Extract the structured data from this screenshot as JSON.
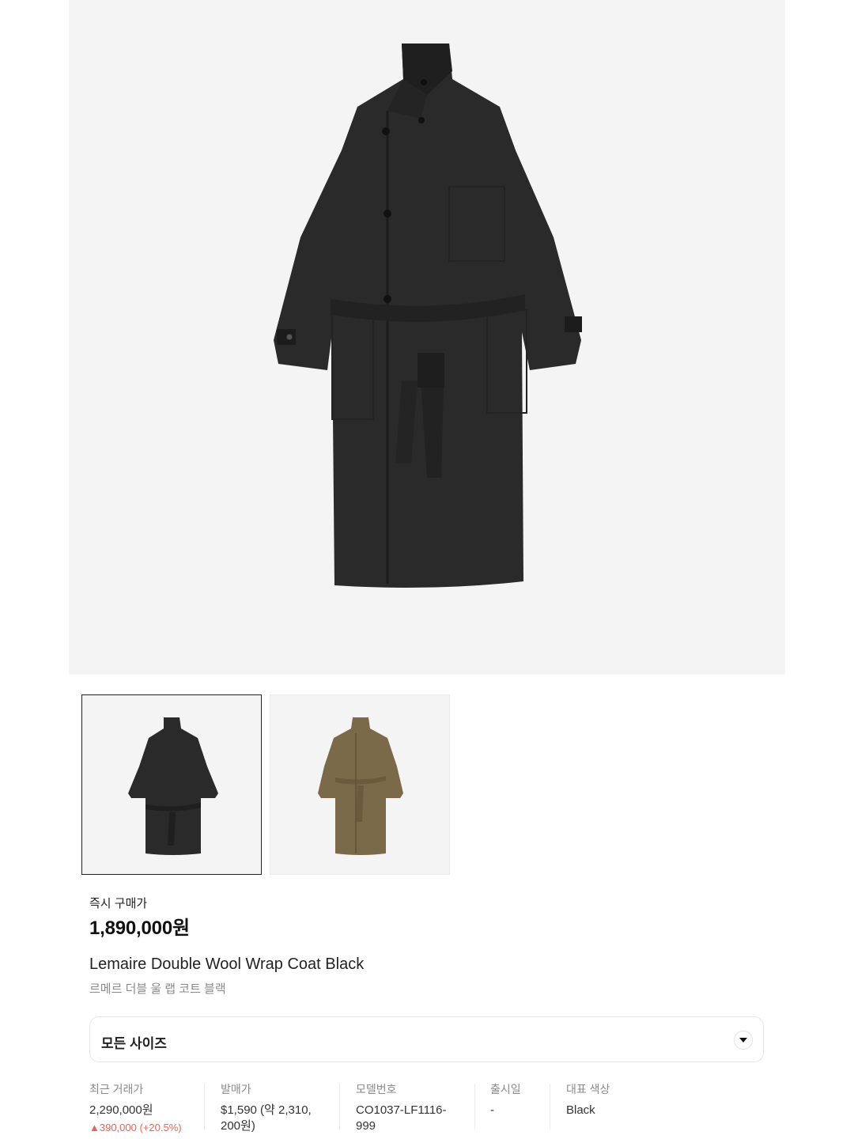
{
  "product": {
    "price_label": "즉시 구매가",
    "price": "1,890,000원",
    "name_en": "Lemaire Double Wool Wrap Coat Black",
    "name_ko": "르메르 더블 울 랩 코트 블랙"
  },
  "images": {
    "main_color": "black",
    "thumbnails": [
      {
        "color": "black",
        "selected": true
      },
      {
        "color": "olive brown",
        "selected": false
      }
    ]
  },
  "size_select": {
    "label": "모든 사이즈"
  },
  "details": {
    "recent_trade_label": "최근 거래가",
    "recent_trade_value": "2,290,000원",
    "recent_trade_change": "▲390,000 (+20.5%)",
    "release_price_label": "발매가",
    "release_price_line1": "$1,590 (약 2,310,",
    "release_price_line2": "200원)",
    "model_number_label": "모델번호",
    "model_number_line1": "CO1037-LF1116-",
    "model_number_line2": "999",
    "release_date_label": "출시일",
    "release_date_value": "-",
    "color_label": "대표 색상",
    "color_value": "Black"
  },
  "colors": {
    "hero_bg": "#f4f4f4",
    "coat_black": "#2a2a2a",
    "coat_olive": "#7b6a4a",
    "up_red": "#ef6253"
  }
}
